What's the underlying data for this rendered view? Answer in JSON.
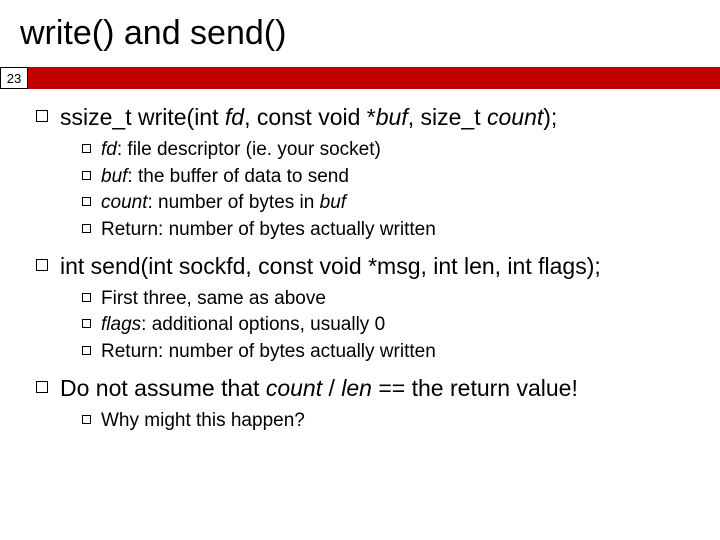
{
  "title": "write() and send()",
  "page_number": "23",
  "sections": [
    {
      "heading_parts": [
        "ssize_t write(int ",
        "fd",
        ", const void *",
        "buf",
        ", size_t ",
        "count",
        ");"
      ],
      "subs": [
        {
          "parts": [
            "",
            "fd",
            ": file descriptor (ie. your socket)"
          ]
        },
        {
          "parts": [
            "",
            "buf",
            ": the buffer of data to send"
          ]
        },
        {
          "parts": [
            "",
            "count",
            ": number of bytes in ",
            "buf",
            ""
          ]
        },
        {
          "parts": [
            "Return: number of bytes actually written"
          ]
        }
      ]
    },
    {
      "heading_parts": [
        "int send(int sockfd, const void *msg, int len, int flags);"
      ],
      "subs": [
        {
          "parts": [
            "First three, same as above"
          ]
        },
        {
          "parts": [
            "",
            "flags",
            ": additional options, usually 0"
          ]
        },
        {
          "parts": [
            "Return: number of bytes actually written"
          ]
        }
      ]
    },
    {
      "heading_parts": [
        "Do not assume that ",
        "count",
        " / ",
        "len",
        " == the return value!"
      ],
      "subs": [
        {
          "parts": [
            "Why might this happen?"
          ]
        }
      ]
    }
  ]
}
